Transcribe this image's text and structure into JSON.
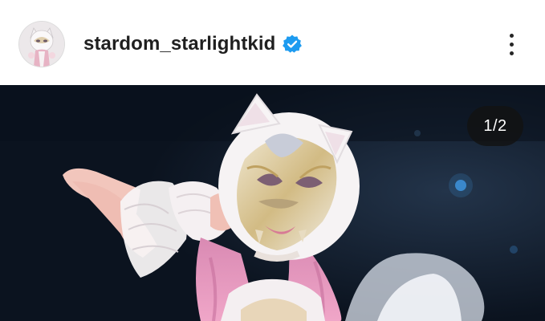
{
  "post": {
    "username": "stardom_starlightkid",
    "verified": true,
    "image_counter": "1/2"
  },
  "icons": {
    "verified": "verified-badge-icon",
    "more": "more-options-icon"
  },
  "colors": {
    "verified_blue": "#1d9bf0",
    "counter_bg": "#121212",
    "photo_bg": "#0d1724"
  }
}
